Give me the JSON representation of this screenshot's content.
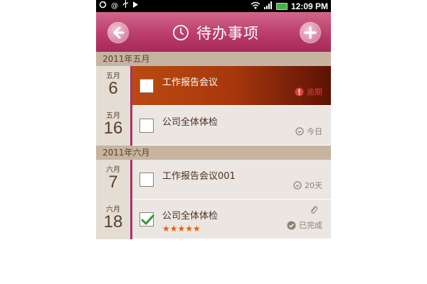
{
  "status_bar": {
    "time": "12:09 PM",
    "icons": [
      "sync-icon",
      "at-icon",
      "usb-icon",
      "play-icon",
      "wifi-icon",
      "signal-icon",
      "battery-icon"
    ]
  },
  "header": {
    "title": "待办事项",
    "back_icon": "back-arrow-icon",
    "clock_icon": "clock-icon",
    "add_icon": "plus-icon"
  },
  "sections": [
    {
      "label": "2011年五月",
      "items": [
        {
          "month": "五月",
          "day": "6",
          "title": "工作报告会议",
          "status": "逾期",
          "status_icon": "alert-icon",
          "checked": false,
          "overdue": true
        },
        {
          "month": "五月",
          "day": "16",
          "title": "公司全体体检",
          "status": "今日",
          "status_icon": "time-icon",
          "checked": false,
          "overdue": false
        }
      ]
    },
    {
      "label": "2011年六月",
      "items": [
        {
          "month": "六月",
          "day": "7",
          "title": "工作报告会议001",
          "status": "20天",
          "status_icon": "time-icon",
          "checked": false,
          "overdue": false
        },
        {
          "month": "六月",
          "day": "18",
          "title": "公司全体体检",
          "status": "已完成",
          "status_icon": "done-icon",
          "checked": true,
          "overdue": false,
          "rating": 5,
          "stars": "★★★★★",
          "attachment_icon": "paperclip-icon"
        }
      ]
    }
  ],
  "colors": {
    "title_bar": "#b93a68",
    "section_header": "#c6b4a1",
    "accent": "#a8326a",
    "overdue_text": "#d9403a",
    "star": "#e85d0e"
  }
}
